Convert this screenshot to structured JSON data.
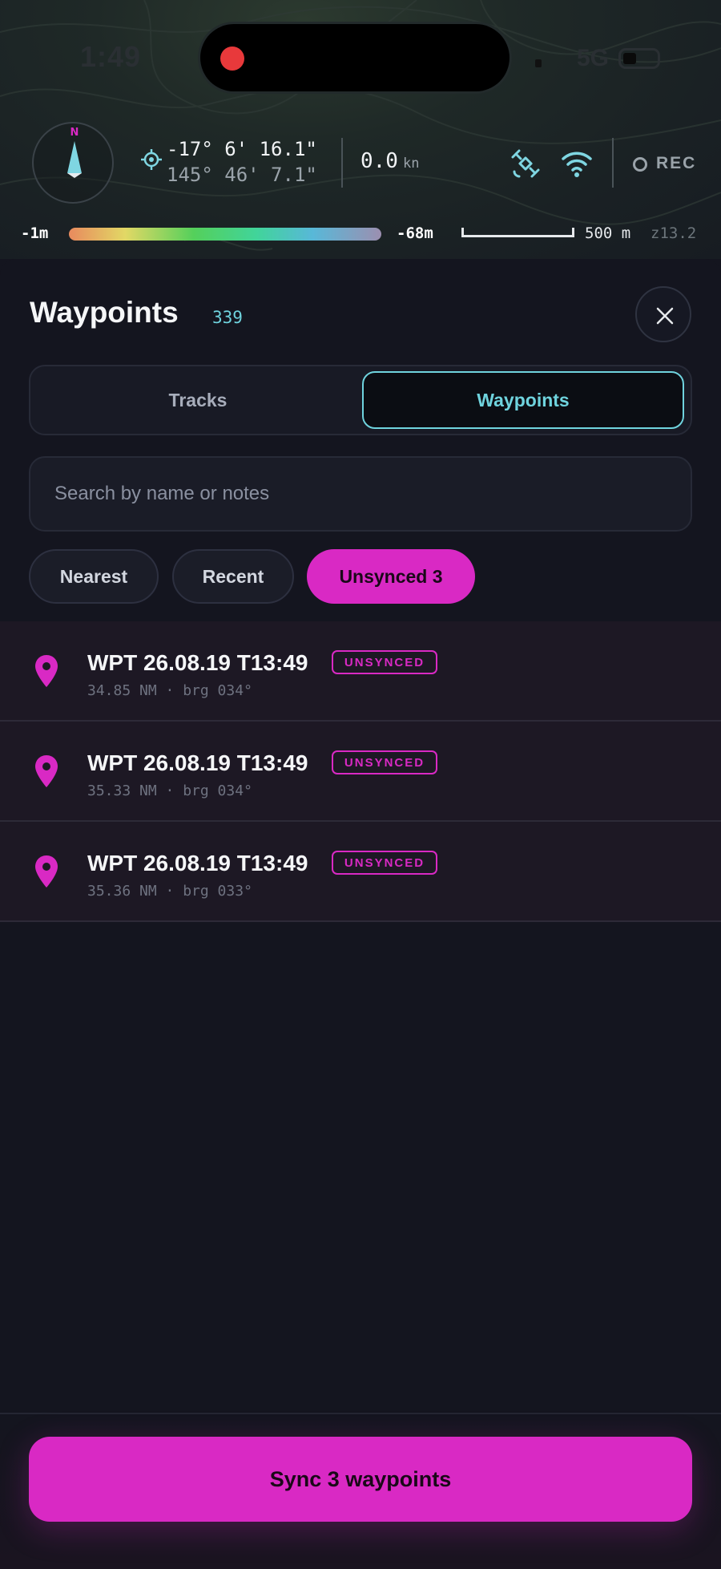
{
  "status_bar": {
    "time": "1:49",
    "network": "5G"
  },
  "map_hud": {
    "compass_label": "N",
    "lat": "-17° 6' 16.1\"",
    "lon": "145° 46' 7.1\"",
    "speed_value": "0.0",
    "speed_unit": "kn",
    "rec_label": "REC",
    "depth_min": "-1m",
    "depth_max": "-68m",
    "scale_label": "500 m",
    "zoom_label": "z13.2",
    "icons": [
      "compass-icon",
      "target-icon",
      "satellite-icon",
      "wifi-icon",
      "record-icon"
    ]
  },
  "sheet": {
    "title": "Waypoints",
    "count": "339",
    "close_icon": "close-icon",
    "tabs": [
      {
        "label": "Tracks",
        "active": false
      },
      {
        "label": "Waypoints",
        "active": true
      }
    ],
    "search_placeholder": "Search by name or notes",
    "filters": [
      {
        "label": "Nearest",
        "active": false
      },
      {
        "label": "Recent",
        "active": false
      },
      {
        "label": "Unsynced 3",
        "active": true
      }
    ],
    "waypoints": [
      {
        "name": "WPT 26.08.19 T13:49",
        "badge": "UNSYNCED",
        "meta": "34.85 NM · brg 034°"
      },
      {
        "name": "WPT 26.08.19 T13:49",
        "badge": "UNSYNCED",
        "meta": "35.33 NM · brg 034°"
      },
      {
        "name": "WPT 26.08.19 T13:49",
        "badge": "UNSYNCED",
        "meta": "35.36 NM · brg 033°"
      }
    ],
    "sync_button_label": "Sync 3 waypoints"
  },
  "colors": {
    "accent_magenta": "#d929c4",
    "accent_cyan": "#6fd3de",
    "background": "#14151f",
    "rec_dot": "#e8393b"
  }
}
